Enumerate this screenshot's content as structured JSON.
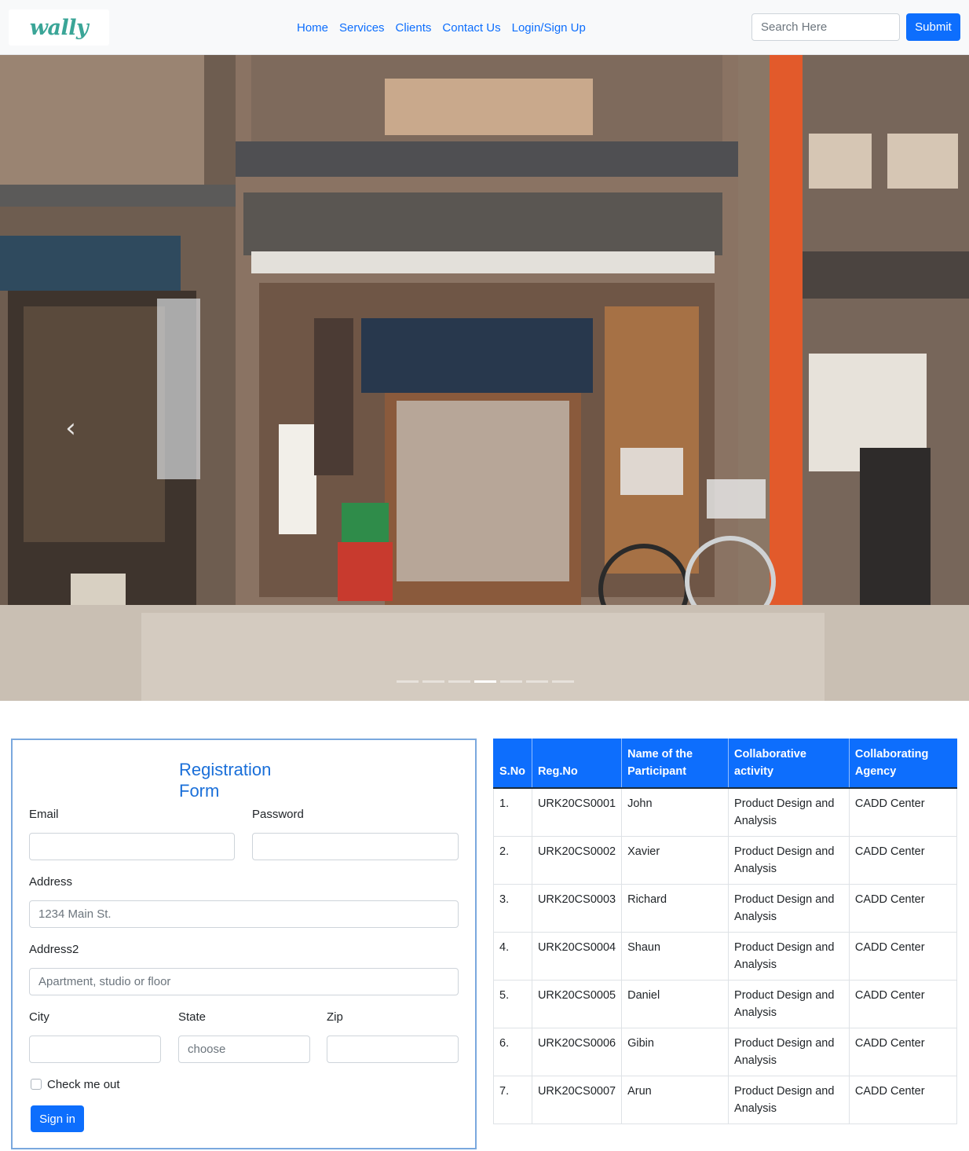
{
  "navbar": {
    "brand": "wally",
    "links": [
      "Home",
      "Services",
      "Clients",
      "Contact Us",
      "Login/Sign Up"
    ],
    "search_placeholder": "Search Here",
    "submit_label": "Submit"
  },
  "carousel": {
    "prev_icon": "chevron-left-icon",
    "indicator_count": 7,
    "active_indicator": 4
  },
  "form": {
    "title": "Registration Form",
    "email_label": "Email",
    "password_label": "Password",
    "address_label": "Address",
    "address_placeholder": "1234 Main St.",
    "address2_label": "Address2",
    "address2_placeholder": "Apartment, studio or floor",
    "city_label": "City",
    "state_label": "State",
    "state_placeholder": "choose",
    "zip_label": "Zip",
    "check_label": "Check me out",
    "signin_label": "Sign in"
  },
  "table": {
    "headers": [
      "S.No",
      "Reg.No",
      "Name of the Participant",
      "Collaborative activity",
      "Collaborating Agency"
    ],
    "rows": [
      [
        "1.",
        "URK20CS0001",
        "John",
        "Product Design and Analysis",
        "CADD Center"
      ],
      [
        "2.",
        "URK20CS0002",
        "Xavier",
        "Product Design and Analysis",
        "CADD Center"
      ],
      [
        "3.",
        "URK20CS0003",
        "Richard",
        "Product Design and Analysis",
        "CADD Center"
      ],
      [
        "4.",
        "URK20CS0004",
        "Shaun",
        "Product Design and Analysis",
        "CADD Center"
      ],
      [
        "5.",
        "URK20CS0005",
        "Daniel",
        "Product Design and Analysis",
        "CADD Center"
      ],
      [
        "6.",
        "URK20CS0006",
        "Gibin",
        "Product Design and Analysis",
        "CADD Center"
      ],
      [
        "7.",
        "URK20CS0007",
        "Arun",
        "Product Design and Analysis",
        "CADD Center"
      ]
    ]
  },
  "colors": {
    "primary": "#0d6efd",
    "brand": "#3aa597",
    "form_border": "#7aa8de"
  }
}
